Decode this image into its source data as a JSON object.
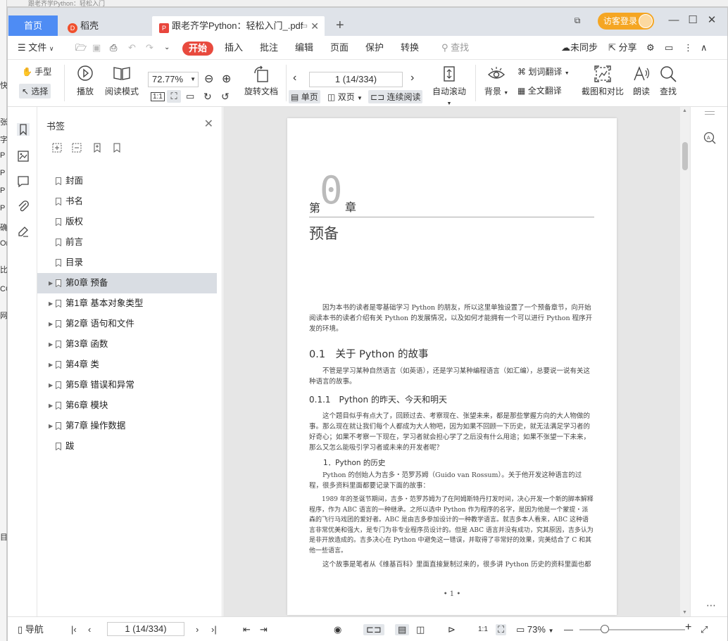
{
  "bg": {
    "title_fragment": "跟老齐学Python：轻松入门",
    "strip": [
      "快",
      "张",
      "字",
      "P",
      "P",
      "P",
      "P",
      "确",
      "On",
      "比",
      "CC",
      "网",
      "目"
    ]
  },
  "tabs": {
    "home": "首页",
    "daoke": "稻壳",
    "doc": "跟老齐学Python：轻松入门_.pdf",
    "visitor": "访客登录"
  },
  "menu": {
    "file": "文件",
    "start": "开始",
    "items": [
      "插入",
      "批注",
      "编辑",
      "页面",
      "保护",
      "转换"
    ],
    "search_placeholder": "查找",
    "unsync": "未同步",
    "share": "分享"
  },
  "toolbar": {
    "hand": "手型",
    "select": "选择",
    "play": "播放",
    "read_mode": "阅读模式",
    "zoom": "72.77%",
    "rotate": "旋转文档",
    "page": "1 (14/334)",
    "single": "单页",
    "double": "双页",
    "continuous": "连续阅读",
    "autoscroll": "自动滚动",
    "background": "背景",
    "word_translate": "划词翻译",
    "full_translate": "全文翻译",
    "screenshot": "截图和对比",
    "read_aloud": "朗读",
    "find": "查找"
  },
  "bookmarks": {
    "title": "书签",
    "items": [
      {
        "label": "封面",
        "expandable": false,
        "selected": false
      },
      {
        "label": "书名",
        "expandable": false,
        "selected": false
      },
      {
        "label": "版权",
        "expandable": false,
        "selected": false
      },
      {
        "label": "前言",
        "expandable": false,
        "selected": false
      },
      {
        "label": "目录",
        "expandable": false,
        "selected": false
      },
      {
        "label": "第0章 预备",
        "expandable": true,
        "selected": true
      },
      {
        "label": "第1章 基本对象类型",
        "expandable": true,
        "selected": false
      },
      {
        "label": "第2章 语句和文件",
        "expandable": true,
        "selected": false
      },
      {
        "label": "第3章 函数",
        "expandable": true,
        "selected": false
      },
      {
        "label": "第4章 类",
        "expandable": true,
        "selected": false
      },
      {
        "label": "第5章 错误和异常",
        "expandable": true,
        "selected": false
      },
      {
        "label": "第6章 模块",
        "expandable": true,
        "selected": false
      },
      {
        "label": "第7章 操作数据",
        "expandable": true,
        "selected": false
      },
      {
        "label": "跋",
        "expandable": false,
        "selected": false
      }
    ]
  },
  "doc": {
    "chapter_pre": "第",
    "chapter_num": "0",
    "chapter_post": "章",
    "chapter_title": "预备",
    "intro": "因为本书的读者是零基础学习 Python 的朋友，所以这里单独设置了一个预备章节，向开始阅读本书的读者介绍有关 Python 的发展情况，以及如何才能拥有一个可以进行 Python 程序开发的环境。",
    "s1": "0.1　关于 Python 的故事",
    "s1_text": "不管是学习某种自然语言（如英语），还是学习某种编程语言（如汇编），总要说一说有关这种语言的故事。",
    "s11": "0.1.1　Python 的昨天、今天和明天",
    "s11_text": "这个题目似乎有点大了，回顾过去、考察现在、张望未来，都是那些掌握方向的大人物做的事。那么现在就让我们每个人都成为大人物吧，因为如果不回顾一下历史，就无法满足学习者的好奇心；如果不考察一下现在，学习者就会担心学了之后没有什么用途；如果不张望一下未来，那么又怎么能吸引学习者或未来的开发者呢？",
    "s111": "1．Python 的历史",
    "s111_text": "Python 的创始人为吉多・范罗苏姆（Guido van Rossum）。关于他开发这种语言的过程，很多资料里面都要记录下面的故事：",
    "quote": "1989 年的圣诞节期间，吉多・范罗苏姆为了在阿姆斯特丹打发时间，决心开发一个新的脚本解释程序，作为 ABC 语言的一种继承。之所以选中 Python 作为程序的名字，是因为他是一个蒙提・派森的飞行马戏团的爱好者。ABC 是由吉多参加设计的一种教学语言。就吉多本人看来，ABC 这种语言非常优美和强大，是专门为非专业程序员设计的。但是 ABC 语言并没有成功，究其原因，吉多认为是非开放造成的。吉多决心在 Python 中避免这一错误，并取得了非常好的效果，完美结合了 C 和其他一些语言。",
    "last": "这个故事是笔者从《维基百科》里面直接复制过来的，很多讲 Python 历史的资料里面也都",
    "page_number": "• 1 •"
  },
  "status": {
    "nav": "导航",
    "page": "1 (14/334)",
    "zoom": "73%",
    "zoom_level": 0.5
  },
  "colors": {
    "accent": "#4e8cf4",
    "start": "#e84a3e",
    "visitor": "#f5a623"
  }
}
